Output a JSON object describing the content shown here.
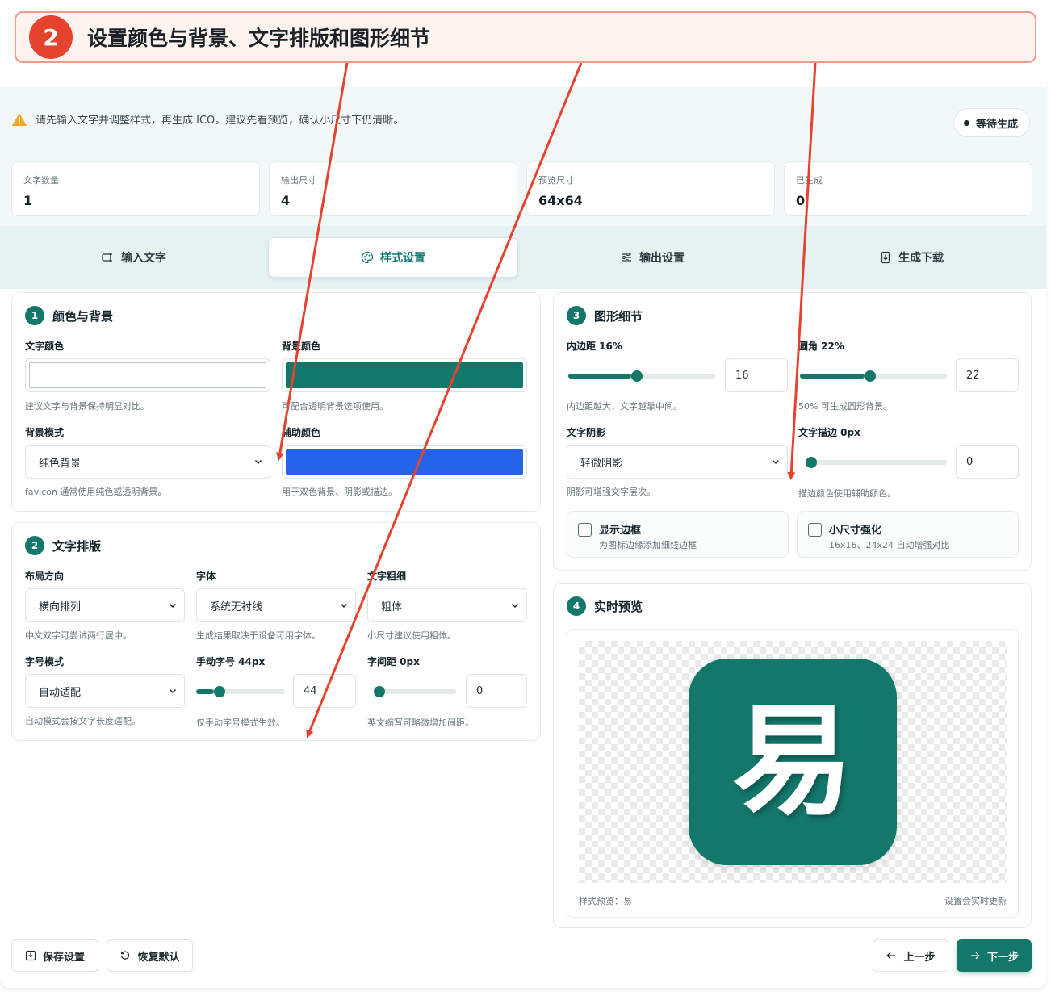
{
  "banner": {
    "step": "2",
    "title": "设置颜色与背景、文字排版和图形细节"
  },
  "notice": {
    "text": "请先输入文字并调整样式，再生成 ICO。建议先看预览，确认小尺寸下仍清晰。",
    "icon": "warning-icon"
  },
  "status": {
    "label": "等待生成"
  },
  "stats": [
    {
      "label": "文字数量",
      "value": "1"
    },
    {
      "label": "输出尺寸",
      "value": "4"
    },
    {
      "label": "预览尺寸",
      "value": "64x64"
    },
    {
      "label": "已生成",
      "value": "0"
    }
  ],
  "tabs": [
    {
      "label": "输入文字",
      "icon": "text-input-icon",
      "active": false
    },
    {
      "label": "样式设置",
      "icon": "palette-icon",
      "active": true
    },
    {
      "label": "输出设置",
      "icon": "sliders-icon",
      "active": false
    },
    {
      "label": "生成下载",
      "icon": "download-file-icon",
      "active": false
    }
  ],
  "color_panel": {
    "num": "1",
    "title": "颜色与背景",
    "text_color": {
      "label": "文字颜色",
      "value": "#ffffff",
      "hint": "建议文字与背景保持明显对比。"
    },
    "bg_color": {
      "label": "背景颜色",
      "value": "#13776a",
      "hint": "可配合透明背景选项使用。"
    },
    "bg_mode": {
      "label": "背景模式",
      "value": "纯色背景",
      "hint": "favicon 通常使用纯色或透明背景。"
    },
    "aux_color": {
      "label": "辅助颜色",
      "value": "#2563eb",
      "hint": "用于双色背景、阴影或描边。"
    }
  },
  "type_panel": {
    "num": "2",
    "title": "文字排版",
    "layout": {
      "label": "布局方向",
      "value": "横向排列",
      "hint": "中文双字可尝试两行居中。"
    },
    "font": {
      "label": "字体",
      "value": "系统无衬线",
      "hint": "生成结果取决于设备可用字体。"
    },
    "weight": {
      "label": "文字粗细",
      "value": "粗体",
      "hint": "小尺寸建议使用粗体。"
    },
    "size_mode": {
      "label": "字号模式",
      "value": "自动适配",
      "hint": "自动模式会按文字长度适配。"
    },
    "manual_size": {
      "label": "手动字号 44px",
      "value": "44",
      "fraction": 0.2,
      "hint": "仅手动字号模式生效。"
    },
    "spacing": {
      "label": "字间距 0px",
      "value": "0",
      "fraction": 0.0,
      "hint": "英文缩写可略微增加间距。"
    }
  },
  "shape_panel": {
    "num": "3",
    "title": "图形细节",
    "padding": {
      "label": "内边距 16%",
      "value": "16",
      "fraction": 0.43,
      "hint": "内边距越大，文字越靠中间。"
    },
    "radius": {
      "label": "圆角 22%",
      "value": "22",
      "fraction": 0.44,
      "hint": "50% 可生成圆形背景。"
    },
    "shadow": {
      "label": "文字阴影",
      "value": "轻微阴影",
      "hint": "阴影可增强文字层次。"
    },
    "stroke": {
      "label": "文字描边 0px",
      "value": "0",
      "fraction": 0.0,
      "hint": "描边颜色使用辅助颜色。"
    },
    "border_check": {
      "title": "显示边框",
      "sub": "为图标边缘添加细线边框",
      "checked": false
    },
    "small_check": {
      "title": "小尺寸强化",
      "sub": "16x16、24x24 自动增强对比",
      "checked": false
    }
  },
  "preview_panel": {
    "num": "4",
    "title": "实时预览",
    "glyph": "易",
    "caption_left": "样式预览：易",
    "caption_right": "设置会实时更新"
  },
  "footer": {
    "save": "保存设置",
    "reset": "恢复默认",
    "prev": "上一步",
    "next": "下一步"
  },
  "colors": {
    "accent": "#13776a",
    "annotation": "#e5432e",
    "aux": "#2563eb"
  }
}
